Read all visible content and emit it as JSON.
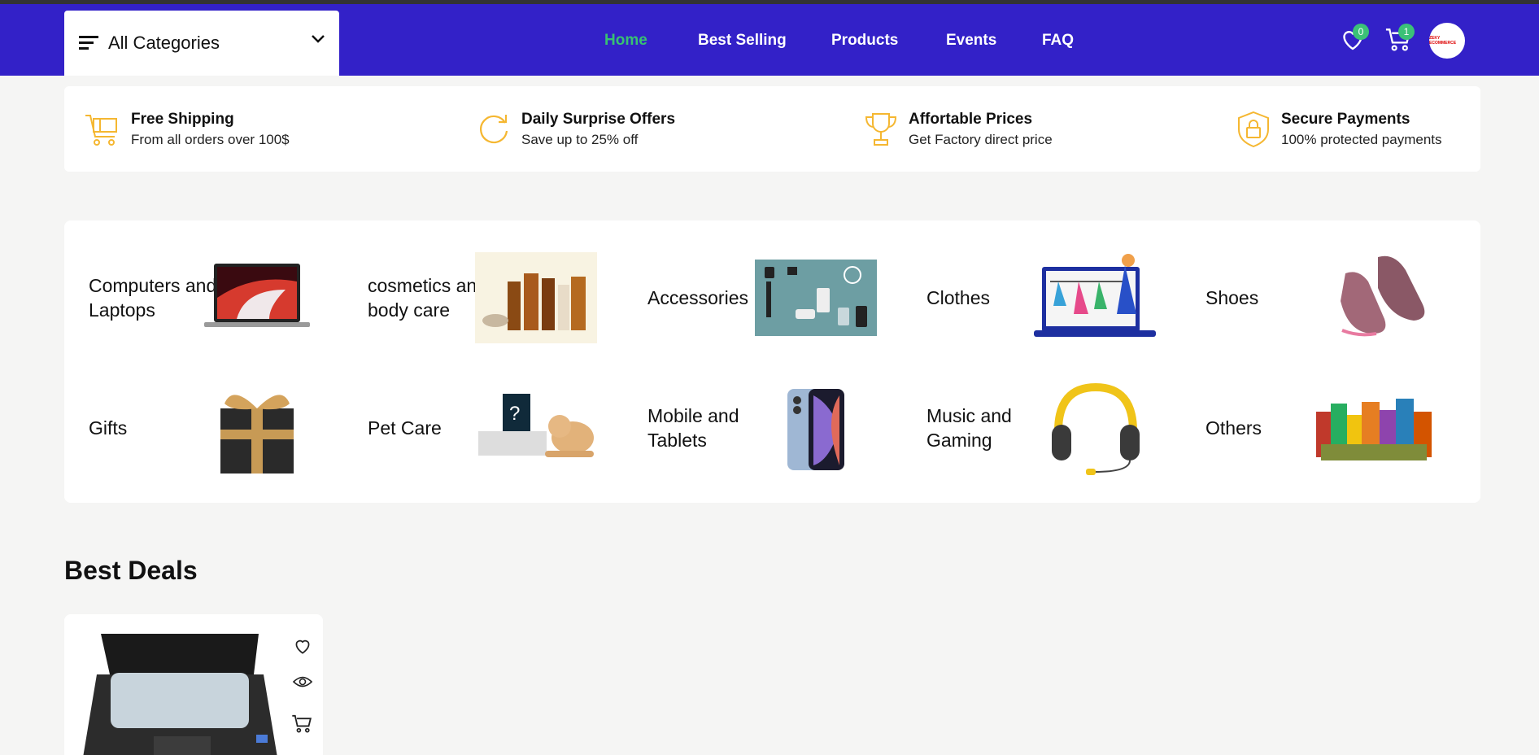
{
  "header": {
    "all_categories_label": "All Categories",
    "nav": [
      {
        "label": "Home",
        "active": true
      },
      {
        "label": "Best Selling",
        "active": false
      },
      {
        "label": "Products",
        "active": false
      },
      {
        "label": "Events",
        "active": false
      },
      {
        "label": "FAQ",
        "active": false
      }
    ],
    "wishlist_count": "0",
    "cart_count": "1",
    "avatar_text": "ZEKY ECOMMERCE"
  },
  "features": [
    {
      "title": "Free Shipping",
      "subtitle": "From all orders over 100$",
      "icon": "cart-icon"
    },
    {
      "title": "Daily Surprise Offers",
      "subtitle": "Save up to 25% off",
      "icon": "refresh-icon"
    },
    {
      "title": "Affortable Prices",
      "subtitle": "Get Factory direct price",
      "icon": "trophy-icon"
    },
    {
      "title": "Secure Payments",
      "subtitle": "100% protected payments",
      "icon": "shield-lock-icon"
    }
  ],
  "categories": [
    {
      "label": "Computers and Laptops",
      "image": "laptop"
    },
    {
      "label": "cosmetics and body care",
      "image": "cosmetics"
    },
    {
      "label": "Accessories",
      "image": "accessories"
    },
    {
      "label": "Clothes",
      "image": "clothes"
    },
    {
      "label": "Shoes",
      "image": "shoes"
    },
    {
      "label": "Gifts",
      "image": "gift"
    },
    {
      "label": "Pet Care",
      "image": "pet"
    },
    {
      "label": "Mobile and Tablets",
      "image": "phone"
    },
    {
      "label": "Music and Gaming",
      "image": "headphones"
    },
    {
      "label": "Others",
      "image": "groceries"
    }
  ],
  "deals": {
    "title": "Best Deals"
  },
  "colors": {
    "nav_bg": "#3321c8",
    "active_nav": "#38c172",
    "badge": "#3bc177",
    "feature_icon": "#f5b731"
  }
}
